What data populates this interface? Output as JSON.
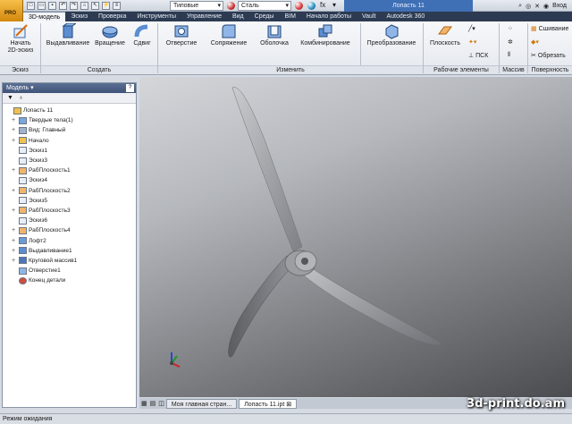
{
  "app": {
    "menu_label": "РRO"
  },
  "title_bar": {
    "style_dropdown": "Типовые",
    "material_dropdown": "Сталь",
    "document_title": "Лопасть 11",
    "login_label": "Вход"
  },
  "tabs": [
    "3D-модель",
    "Эскиз",
    "Проверка",
    "Инструменты",
    "Управление",
    "Вид",
    "Среды",
    "BIM",
    "Начало работы",
    "Vault",
    "Autodesk 360"
  ],
  "ribbon": {
    "sketch_button": "Начать\n2D-эскиз",
    "extrude": "Выдавливание",
    "revolve": "Вращение",
    "sweep": "Сдвиг",
    "hole": "Отверстие",
    "fillet": "Сопряжение",
    "shell": "Оболочка",
    "combine": "Комбинирование",
    "transform": "Преобразование",
    "plane": "Плоскость",
    "ucs": "ПСК",
    "stitch": "Сшивание",
    "trim": "Обрезать",
    "panels": {
      "sketch": "Эскиз",
      "create": "Создать",
      "modify": "Изменить",
      "work_features": "Рабочие элементы",
      "pattern": "Массив",
      "surface": "Поверхность"
    }
  },
  "browser": {
    "title": "Модель",
    "tree": [
      {
        "label": "Лопасть 11",
        "level": 0,
        "expander": ""
      },
      {
        "label": "Твердые тела(1)",
        "level": 1,
        "expander": "+"
      },
      {
        "label": "Вид: Главный",
        "level": 1,
        "expander": "+"
      },
      {
        "label": "Начало",
        "level": 1,
        "expander": "+"
      },
      {
        "label": "Эскиз1",
        "level": 1,
        "expander": ""
      },
      {
        "label": "Эскиз3",
        "level": 1,
        "expander": ""
      },
      {
        "label": "РабПлоскость1",
        "level": 1,
        "expander": "+"
      },
      {
        "label": "Эскиз4",
        "level": 1,
        "expander": ""
      },
      {
        "label": "РабПлоскость2",
        "level": 1,
        "expander": "+"
      },
      {
        "label": "Эскиз5",
        "level": 1,
        "expander": ""
      },
      {
        "label": "РабПлоскость3",
        "level": 1,
        "expander": "+"
      },
      {
        "label": "Эскиз6",
        "level": 1,
        "expander": ""
      },
      {
        "label": "РабПлоскость4",
        "level": 1,
        "expander": "+"
      },
      {
        "label": "Лофт2",
        "level": 1,
        "expander": "+"
      },
      {
        "label": "Выдавливание1",
        "level": 1,
        "expander": "+"
      },
      {
        "label": "Круговой массив1",
        "level": 1,
        "expander": "+"
      },
      {
        "label": "Отверстие1",
        "level": 1,
        "expander": ""
      },
      {
        "label": "Конец детали",
        "level": 1,
        "expander": ""
      }
    ]
  },
  "document_tabs": [
    "Моя главная стран...",
    "Лопасть 11.ipt"
  ],
  "status": "Режим ожидания",
  "watermark": "3d-print.do.am",
  "colors": {
    "tab_bar": "#2d3b52",
    "title_doc": "#3f6fb4",
    "app_button": "#e9a524"
  }
}
